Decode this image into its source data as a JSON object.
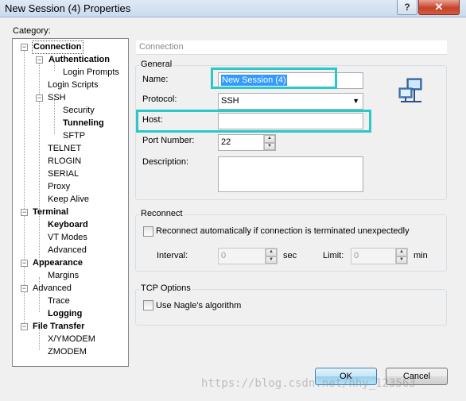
{
  "window": {
    "title": "New Session (4) Properties",
    "help_label": "?",
    "close_label": "✕"
  },
  "category_label": "Category:",
  "tree": {
    "connection": "Connection",
    "authentication": "Authentication",
    "login_prompts": "Login Prompts",
    "login_scripts": "Login Scripts",
    "ssh": "SSH",
    "security": "Security",
    "tunneling": "Tunneling",
    "sftp": "SFTP",
    "telnet": "TELNET",
    "rlogin": "RLOGIN",
    "serial": "SERIAL",
    "proxy": "Proxy",
    "keep_alive": "Keep Alive",
    "terminal": "Terminal",
    "keyboard": "Keyboard",
    "vt_modes": "VT Modes",
    "advanced_terminal": "Advanced",
    "appearance": "Appearance",
    "margins": "Margins",
    "advanced": "Advanced",
    "trace": "Trace",
    "logging": "Logging",
    "file_transfer": "File Transfer",
    "xymodem": "X/YMODEM",
    "zmodem": "ZMODEM"
  },
  "panel": {
    "header": "Connection",
    "general": {
      "title": "General",
      "name_label": "Name:",
      "name_value": "New Session (4)",
      "protocol_label": "Protocol:",
      "protocol_value": "SSH",
      "host_label": "Host:",
      "host_value": "",
      "port_label": "Port Number:",
      "port_value": "22",
      "description_label": "Description:",
      "description_value": ""
    },
    "reconnect": {
      "title": "Reconnect",
      "checkbox_label": "Reconnect automatically if connection is terminated unexpectedly",
      "interval_label": "Interval:",
      "interval_value": "0",
      "interval_unit": "sec",
      "limit_label": "Limit:",
      "limit_value": "0",
      "limit_unit": "min"
    },
    "tcp": {
      "title": "TCP Options",
      "nagle_label": "Use Nagle's algorithm"
    }
  },
  "buttons": {
    "ok": "OK",
    "cancel": "Cancel"
  },
  "watermark": "https://blog.csdn.net/hhy_123563",
  "colors": {
    "highlight": "#2cc7c7",
    "selection": "#3399ff"
  }
}
